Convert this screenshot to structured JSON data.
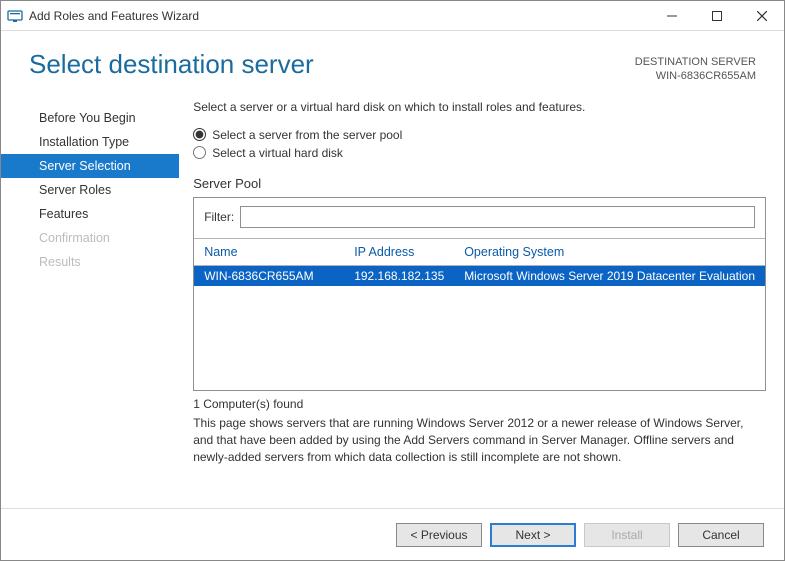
{
  "window": {
    "title": "Add Roles and Features Wizard"
  },
  "header": {
    "title": "Select destination server",
    "destLabel": "DESTINATION SERVER",
    "destValue": "WIN-6836CR655AM"
  },
  "nav": {
    "items": [
      {
        "label": "Before You Begin",
        "state": "normal"
      },
      {
        "label": "Installation Type",
        "state": "normal"
      },
      {
        "label": "Server Selection",
        "state": "active"
      },
      {
        "label": "Server Roles",
        "state": "normal"
      },
      {
        "label": "Features",
        "state": "normal"
      },
      {
        "label": "Confirmation",
        "state": "disabled"
      },
      {
        "label": "Results",
        "state": "disabled"
      }
    ]
  },
  "main": {
    "intro": "Select a server or a virtual hard disk on which to install roles and features.",
    "radioPool": "Select a server from the server pool",
    "radioVhd": "Select a virtual hard disk",
    "sectionLabel": "Server Pool",
    "filterLabel": "Filter:",
    "filterValue": "",
    "columns": {
      "name": "Name",
      "ip": "IP Address",
      "os": "Operating System"
    },
    "rows": [
      {
        "name": "WIN-6836CR655AM",
        "ip": "192.168.182.135",
        "os": "Microsoft Windows Server 2019 Datacenter Evaluation"
      }
    ],
    "foundText": "1 Computer(s) found",
    "note": "This page shows servers that are running Windows Server 2012 or a newer release of Windows Server, and that have been added by using the Add Servers command in Server Manager. Offline servers and newly-added servers from which data collection is still incomplete are not shown."
  },
  "footer": {
    "previous": "< Previous",
    "next": "Next >",
    "install": "Install",
    "cancel": "Cancel"
  }
}
